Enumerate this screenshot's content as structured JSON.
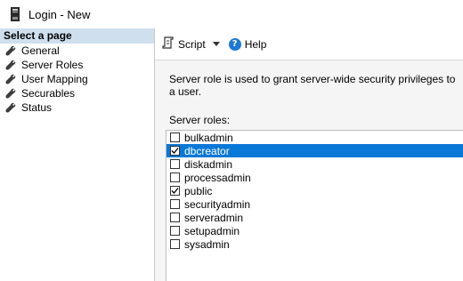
{
  "window": {
    "title": "Login - New"
  },
  "sidebar": {
    "header": "Select a page",
    "items": [
      {
        "label": "General",
        "icon": "wrench-icon"
      },
      {
        "label": "Server Roles",
        "icon": "wrench-icon"
      },
      {
        "label": "User Mapping",
        "icon": "wrench-icon"
      },
      {
        "label": "Securables",
        "icon": "wrench-icon"
      },
      {
        "label": "Status",
        "icon": "wrench-icon"
      }
    ]
  },
  "toolbar": {
    "script_label": "Script",
    "help_label": "Help"
  },
  "main": {
    "description": "Server role is used to grant server-wide security privileges to a user.",
    "roles_label": "Server roles:",
    "roles": [
      {
        "name": "bulkadmin",
        "checked": false,
        "selected": false
      },
      {
        "name": "dbcreator",
        "checked": true,
        "selected": true
      },
      {
        "name": "diskadmin",
        "checked": false,
        "selected": false
      },
      {
        "name": "processadmin",
        "checked": false,
        "selected": false
      },
      {
        "name": "public",
        "checked": true,
        "selected": false
      },
      {
        "name": "securityadmin",
        "checked": false,
        "selected": false
      },
      {
        "name": "serveradmin",
        "checked": false,
        "selected": false
      },
      {
        "name": "setupadmin",
        "checked": false,
        "selected": false
      },
      {
        "name": "sysadmin",
        "checked": false,
        "selected": false
      }
    ]
  },
  "colors": {
    "selection": "#0a78d7",
    "sidebar_header": "#cfdfee"
  }
}
